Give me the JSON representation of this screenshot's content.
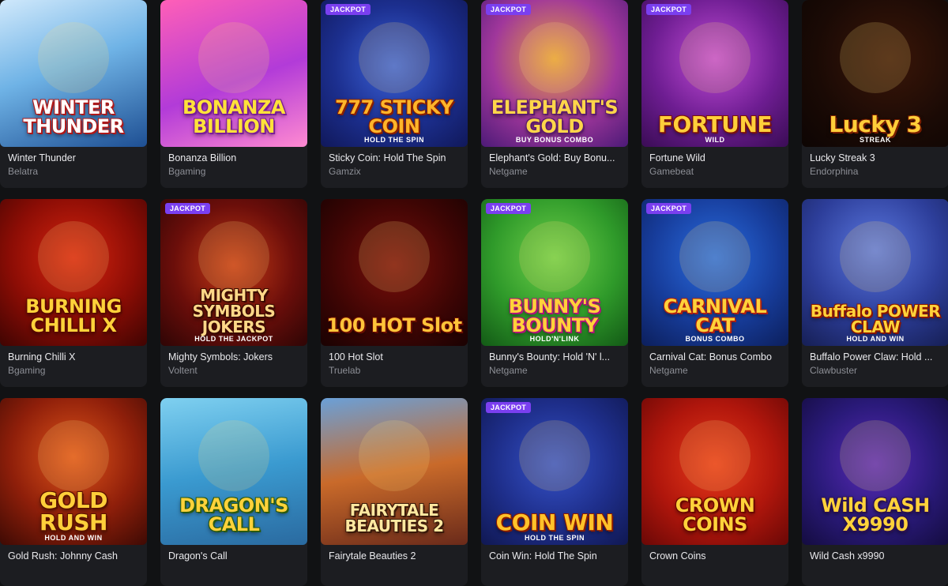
{
  "jackpot_label": "JACKPOT",
  "games": [
    {
      "title": "Winter Thunder",
      "provider": "Belatra",
      "art": "WINTER THUNDER",
      "art_sub": "",
      "jackpot": false,
      "bg": "linear-gradient(160deg,#cfe8fb 0%,#6fb3e6 45%,#1e4f93 100%)",
      "fg": "#ffffff",
      "stroke": "#b01818"
    },
    {
      "title": "Bonanza Billion",
      "provider": "Bgaming",
      "art": "BONANZA BILLION",
      "art_sub": "",
      "jackpot": false,
      "bg": "linear-gradient(160deg,#ff5fb7 0%,#b23bd8 55%,#ff8ad1 100%)",
      "fg": "#ffe23a",
      "stroke": "#7b1b9a"
    },
    {
      "title": "Sticky Coin: Hold The Spin",
      "provider": "Gamzix",
      "art": "777 STICKY COIN",
      "art_sub": "HOLD THE SPIN",
      "jackpot": true,
      "bg": "radial-gradient(circle at 50% 45%,#3c63d9 0%,#1c2f8f 55%,#10185a 100%)",
      "fg": "#ffb52a",
      "stroke": "#8a1f00"
    },
    {
      "title": "Elephant's Gold: Buy Bonu...",
      "provider": "Netgame",
      "art": "ELEPHANT'S GOLD",
      "art_sub": "BUY BONUS COMBO",
      "jackpot": true,
      "bg": "radial-gradient(circle at 50% 40%,#e8a33a 0%,#a0379b 55%,#4c1a77 100%)",
      "fg": "#ffd54a",
      "stroke": "#5a1a6e"
    },
    {
      "title": "Fortune Wild",
      "provider": "Gamebeat",
      "art": "FORTUNE",
      "art_sub": "WILD",
      "jackpot": true,
      "bg": "radial-gradient(circle at 50% 40%,#c24dd6 0%,#6e1d92 55%,#3a0c55 100%)",
      "fg": "#ffcf3a",
      "stroke": "#7a0f0f"
    },
    {
      "title": "Lucky Streak 3",
      "provider": "Endorphina",
      "art": "Lucky 3",
      "art_sub": "STREAK",
      "jackpot": false,
      "bg": "radial-gradient(circle at 60% 40%,#3b1608 0%,#1a0a05 60%,#0d0503 100%)",
      "fg": "#ffce3a",
      "stroke": "#7a1e00"
    },
    {
      "title": "Burning Chilli X",
      "provider": "Bgaming",
      "art": "BURNING CHILLI X",
      "art_sub": "",
      "jackpot": false,
      "bg": "radial-gradient(circle at 50% 40%,#d8240f 0%,#8c0d05 55%,#3f0402 100%)",
      "fg": "#ffd23a",
      "stroke": "#5a0800"
    },
    {
      "title": "Mighty Symbols: Jokers",
      "provider": "Voltent",
      "art": "MIGHTY SYMBOLS JOKERS",
      "art_sub": "HOLD THE JACKPOT",
      "jackpot": true,
      "bg": "radial-gradient(circle at 50% 45%,#c63a16 0%,#6b0e0a 55%,#2e0505 100%)",
      "fg": "#ffd888",
      "stroke": "#3a0a00"
    },
    {
      "title": "100 Hot Slot",
      "provider": "Truelab",
      "art": "100 HOT Slot",
      "art_sub": "",
      "jackpot": false,
      "bg": "radial-gradient(circle at 50% 45%,#7a0f0a 0%,#3d0504 60%,#1a0202 100%)",
      "fg": "#ffc43a",
      "stroke": "#6a0d00"
    },
    {
      "title": "Bunny's Bounty: Hold 'N' l...",
      "provider": "Netgame",
      "art": "BUNNY'S BOUNTY",
      "art_sub": "HOLD'N'LINK",
      "jackpot": true,
      "bg": "radial-gradient(circle at 50% 40%,#6fd04a 0%,#2f9a2a 55%,#135a16 100%)",
      "fg": "#ffd23a",
      "stroke": "#b0127a"
    },
    {
      "title": "Carnival Cat: Bonus Combo",
      "provider": "Netgame",
      "art": "CARNIVAL CAT",
      "art_sub": "BONUS COMBO",
      "jackpot": true,
      "bg": "radial-gradient(circle at 50% 40%,#2a6de0 0%,#173d9c 55%,#0c1f5c 100%)",
      "fg": "#ffd23a",
      "stroke": "#b02010"
    },
    {
      "title": "Buffalo Power Claw: Hold ...",
      "provider": "Clawbuster",
      "art": "Buffalo POWER CLAW",
      "art_sub": "HOLD AND WIN",
      "jackpot": false,
      "bg": "radial-gradient(circle at 50% 35%,#5b78e0 0%,#2d3e9a 55%,#161f55 100%)",
      "fg": "#ffd23a",
      "stroke": "#8a1500"
    },
    {
      "title": "Gold Rush: Johnny Cash",
      "provider": "",
      "art": "GOLD RUSH",
      "art_sub": "HOLD AND WIN",
      "jackpot": false,
      "bg": "radial-gradient(circle at 50% 40%,#e0541a 0%,#8f1f0a 55%,#3e0a04 100%)",
      "fg": "#ffcf3a",
      "stroke": "#5a1200"
    },
    {
      "title": "Dragon's Call",
      "provider": "",
      "art": "DRAGON'S CALL",
      "art_sub": "",
      "jackpot": false,
      "bg": "linear-gradient(170deg,#7fd0f0 0%,#3a9ad0 50%,#2a6aa0 100%)",
      "fg": "#ffd23a",
      "stroke": "#2a5a10"
    },
    {
      "title": "Fairytale Beauties 2",
      "provider": "",
      "art": "FAIRYTALE BEAUTIES 2",
      "art_sub": "",
      "jackpot": false,
      "bg": "linear-gradient(170deg,#6aa0d8 0%,#c96a2a 50%,#6a2a1a 100%)",
      "fg": "#ffe8a0",
      "stroke": "#3a1a0a"
    },
    {
      "title": "Coin Win: Hold The Spin",
      "provider": "",
      "art": "COIN WIN",
      "art_sub": "HOLD THE SPIN",
      "jackpot": true,
      "bg": "radial-gradient(circle at 50% 45%,#3552c9 0%,#1e2e8a 55%,#101852 100%)",
      "fg": "#ffc22a",
      "stroke": "#8a1a00"
    },
    {
      "title": "Crown Coins",
      "provider": "",
      "art": "CROWN COINS",
      "art_sub": "",
      "jackpot": false,
      "bg": "radial-gradient(circle at 50% 45%,#e83a1a 0%,#b0160c 55%,#6a0806 100%)",
      "fg": "#ffd23a",
      "stroke": "#6a0800"
    },
    {
      "title": "Wild Cash x9990",
      "provider": "",
      "art": "Wild CASH X9990",
      "art_sub": "",
      "jackpot": false,
      "bg": "radial-gradient(circle at 50% 45%,#5a2ab8 0%,#2a1a7a 55%,#140c40 100%)",
      "fg": "#ffd23a",
      "stroke": "#2a1050"
    }
  ]
}
